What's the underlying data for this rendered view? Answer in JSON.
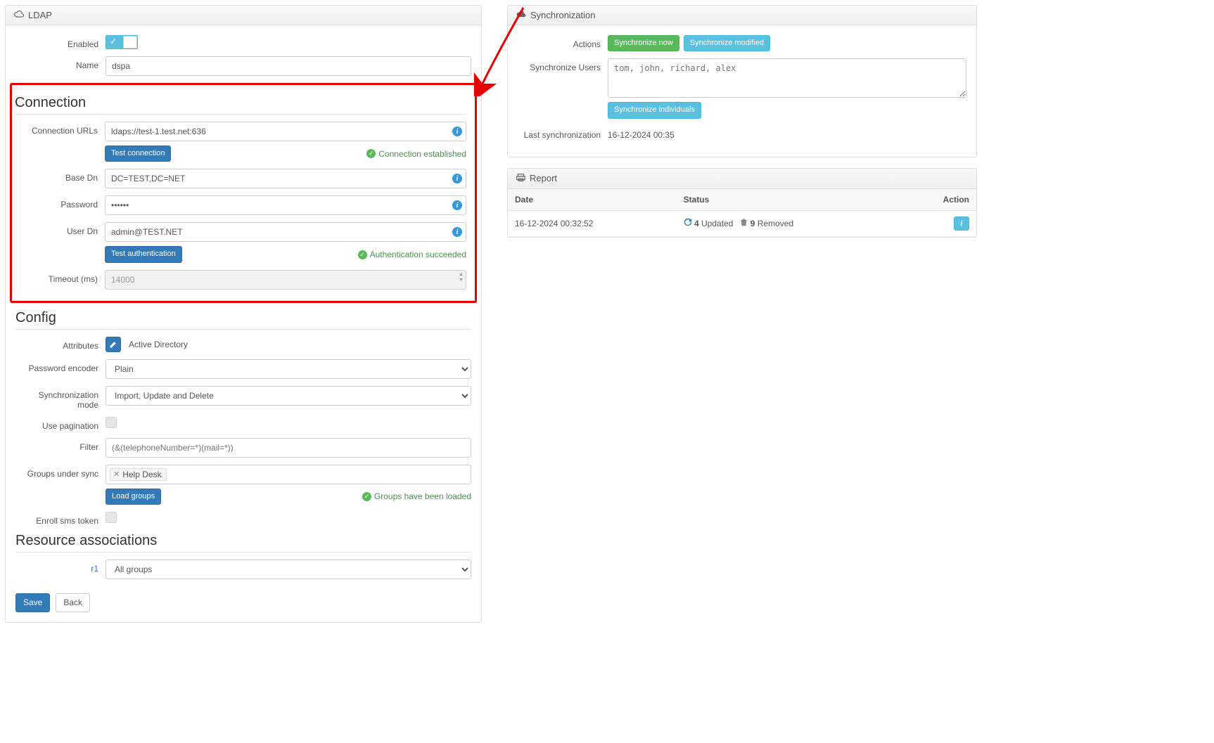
{
  "ldap": {
    "title": "LDAP",
    "enabled_label": "Enabled",
    "enabled": true,
    "name_label": "Name",
    "name_value": "dspa"
  },
  "connection": {
    "title": "Connection",
    "urls_label": "Connection URLs",
    "urls_value": "ldaps://test-1.test.net:636",
    "test_conn_btn": "Test connection",
    "conn_status": "Connection established",
    "base_dn_label": "Base Dn",
    "base_dn_value": "DC=TEST,DC=NET",
    "password_label": "Password",
    "password_value": "••••••",
    "user_dn_label": "User Dn",
    "user_dn_value": "admin@TEST.NET",
    "test_auth_btn": "Test authentication",
    "auth_status": "Authentication succeeded",
    "timeout_label": "Timeout (ms)",
    "timeout_value": "14000"
  },
  "config": {
    "title": "Config",
    "attributes_label": "Attributes",
    "attributes_value": "Active Directory",
    "pwd_encoder_label": "Password encoder",
    "pwd_encoder_value": "Plain",
    "sync_mode_label": "Synchronization mode",
    "sync_mode_value": "Import, Update and Delete",
    "pagination_label": "Use pagination",
    "filter_label": "Filter",
    "filter_placeholder": "(&(telephoneNumber=*)(mail=*))",
    "groups_label": "Groups under sync",
    "group_tag": "Help Desk",
    "load_groups_btn": "Load groups",
    "groups_status": "Groups have been loaded",
    "enroll_sms_label": "Enroll sms token"
  },
  "resource": {
    "title": "Resource associations",
    "r1_label": "r1",
    "r1_value": "All groups"
  },
  "buttons": {
    "save": "Save",
    "back": "Back"
  },
  "sync": {
    "title": "Synchronization",
    "actions_label": "Actions",
    "sync_now_btn": "Synchronize now",
    "sync_mod_btn": "Synchronize modified",
    "sync_users_label": "Synchronize Users",
    "sync_users_placeholder": "tom, john, richard, alex",
    "sync_indiv_btn": "Synchronize individuals",
    "last_sync_label": "Last synchronization",
    "last_sync_value": "16-12-2024 00:35"
  },
  "report": {
    "title": "Report",
    "col_date": "Date",
    "col_status": "Status",
    "col_action": "Action",
    "rows": [
      {
        "date": "16-12-2024 00:32:52",
        "updated_count": "4",
        "updated_label": "Updated",
        "removed_count": "9",
        "removed_label": "Removed"
      }
    ]
  }
}
